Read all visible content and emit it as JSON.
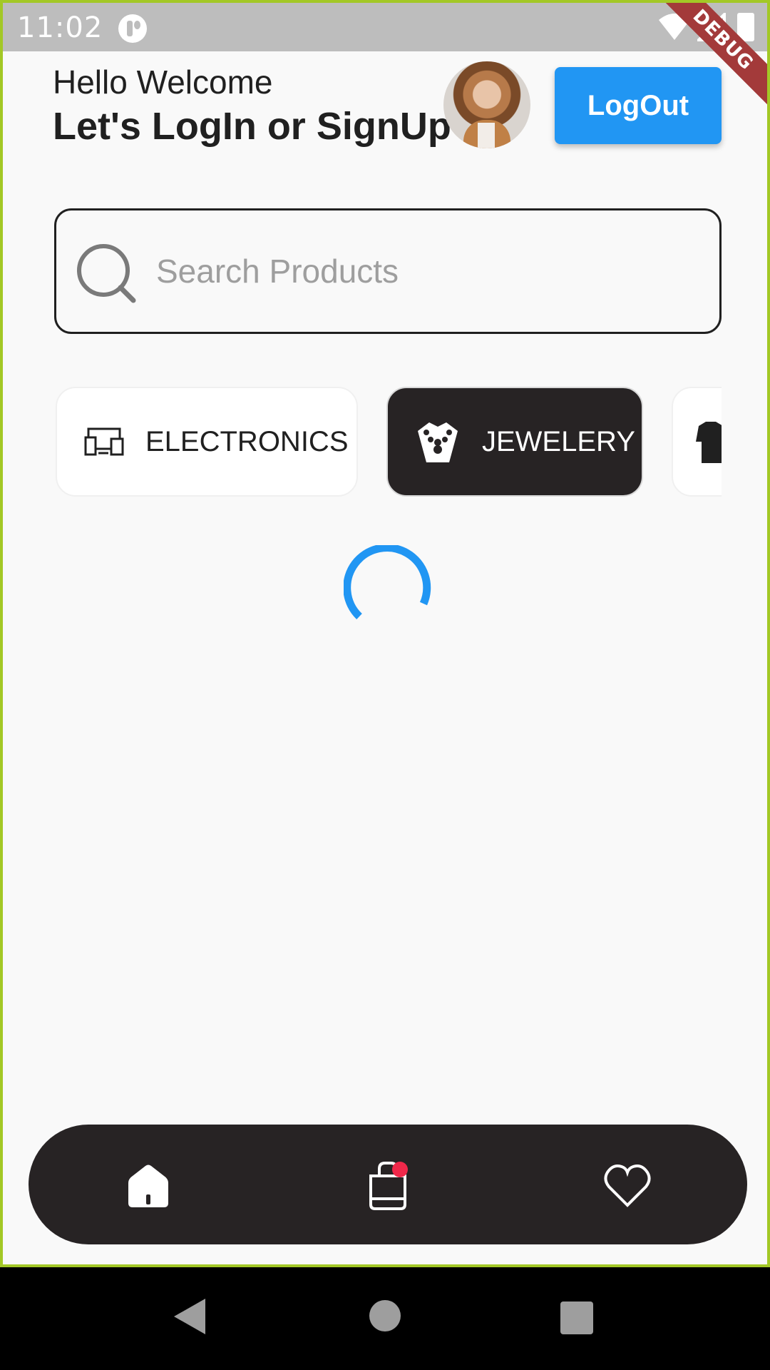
{
  "status_bar": {
    "time": "11:02",
    "debug_label": "DEBUG"
  },
  "header": {
    "greeting": "Hello Welcome",
    "headline": "Let's LogIn or SignUp",
    "logout_label": "LogOut"
  },
  "search": {
    "placeholder": "Search Products",
    "icon": "search-icon"
  },
  "categories": [
    {
      "label": "ELECTRONICS",
      "icon": "devices-icon",
      "selected": false
    },
    {
      "label": "JEWELERY",
      "icon": "necklace-icon",
      "selected": true
    },
    {
      "label": "",
      "icon": "shirt-icon",
      "selected": false
    }
  ],
  "loading": true,
  "bottom_nav": {
    "items": [
      "home-icon",
      "shopping-bag-icon",
      "heart-icon"
    ],
    "cart_has_badge": true
  },
  "colors": {
    "accent": "#2196f3",
    "dark": "#272324",
    "badge": "#f0284a",
    "background": "#f9f9f9"
  }
}
